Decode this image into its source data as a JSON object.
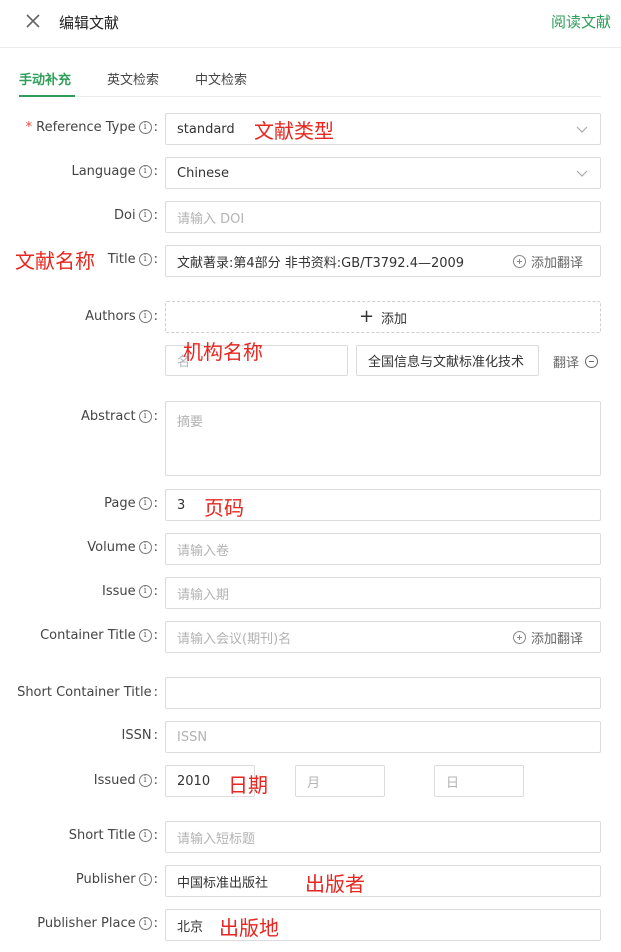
{
  "header": {
    "title": "编辑文献",
    "read_link": "阅读文献"
  },
  "tabs": [
    {
      "label": "手动补充",
      "active": true
    },
    {
      "label": "英文检索",
      "active": false
    },
    {
      "label": "中文检索",
      "active": false
    }
  ],
  "form": {
    "reference_type": {
      "label": "Reference Type",
      "value": "standard",
      "required": true
    },
    "language": {
      "label": "Language",
      "value": "Chinese"
    },
    "doi": {
      "label": "Doi",
      "placeholder": "请输入 DOI"
    },
    "title": {
      "label": "Title",
      "value": "文献著录:第4部分 非书资料:GB/T3792.4—2009",
      "translate": "添加翻译"
    },
    "authors": {
      "label": "Authors",
      "add_label": "添加",
      "name_placeholder": "名",
      "org_value": "全国信息与文献标准化技术",
      "translate": "翻译"
    },
    "abstract": {
      "label": "Abstract",
      "placeholder": "摘要"
    },
    "page": {
      "label": "Page",
      "value": "3"
    },
    "volume": {
      "label": "Volume",
      "placeholder": "请输入卷"
    },
    "issue": {
      "label": "Issue",
      "placeholder": "请输入期"
    },
    "container_title": {
      "label": "Container Title",
      "placeholder": "请输入会议(期刊)名",
      "translate": "添加翻译"
    },
    "short_container_title": {
      "label": "Short Container Title",
      "value": ""
    },
    "issn": {
      "label": "ISSN",
      "placeholder": "ISSN"
    },
    "issued": {
      "label": "Issued",
      "year": "2010",
      "month_placeholder": "月",
      "day_placeholder": "日"
    },
    "short_title": {
      "label": "Short Title",
      "placeholder": "请输入短标题"
    },
    "publisher": {
      "label": "Publisher",
      "value": "中国标准出版社"
    },
    "publisher_place": {
      "label": "Publisher Place",
      "value": "北京"
    }
  },
  "annotations": {
    "reference_type": "文献类型",
    "title": "文献名称",
    "org": "机构名称",
    "page": "页码",
    "issued": "日期",
    "publisher": "出版者",
    "publisher_place": "出版地"
  },
  "colors": {
    "accent": "#2e9e59",
    "annotation": "#e6261f"
  }
}
